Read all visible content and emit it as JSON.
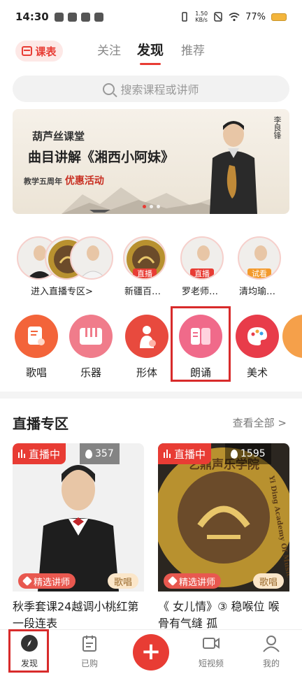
{
  "status_bar": {
    "time": "14:30",
    "speed_top": "1.50",
    "speed_bottom": "KB/s",
    "battery": "77%"
  },
  "header": {
    "schedule_label": "课表",
    "tabs": [
      {
        "label": "关注"
      },
      {
        "label": "发现"
      },
      {
        "label": "推荐"
      }
    ],
    "active_tab": "发现"
  },
  "search": {
    "placeholder": "搜索课程或讲师"
  },
  "banner": {
    "line1": "葫芦丝课堂",
    "line2": "曲目讲解《湘西小阿妹》",
    "line3_prefix": "教学五周年",
    "line3_highlight": "优惠活动",
    "seal": "李良锋",
    "page": 1,
    "page_count": 3
  },
  "live_entries": {
    "enter_label": "进入直播专区>",
    "teachers": [
      {
        "name": "新疆百…",
        "badge": "直播"
      },
      {
        "name": "罗老师…",
        "badge": "直播"
      },
      {
        "name": "清均瑜…",
        "badge": "试看"
      }
    ]
  },
  "categories": [
    {
      "label": "歌唱",
      "color": "#f3643a",
      "icon": "music-note-icon"
    },
    {
      "label": "乐器",
      "color": "#f07c8b",
      "icon": "piano-icon"
    },
    {
      "label": "形体",
      "color": "#e84a3e",
      "icon": "dancer-icon"
    },
    {
      "label": "朗诵",
      "color": "#f06a8a",
      "icon": "book-icon"
    },
    {
      "label": "美术",
      "color": "#e83c4a",
      "icon": "palette-icon"
    }
  ],
  "live_section": {
    "title": "直播专区",
    "see_all": "查看全部 >",
    "cards": [
      {
        "live_label": "直播中",
        "viewers": "357",
        "tutor_label": "精选讲师",
        "genre": "歌唱",
        "title": "秋季套课24越调小桃红第一段连表"
      },
      {
        "live_label": "直播中",
        "viewers": "1595",
        "tutor_label": "精选讲师",
        "genre": "歌唱",
        "title": "《 女儿情》③ 稳喉位 喉骨有气缝 孤",
        "logo_text": "艺鼎声乐学院",
        "logo_text_en": "Yi Ding Academy Of Music"
      }
    ]
  },
  "bottom_nav": {
    "items": [
      {
        "label": "发现",
        "icon": "compass-icon"
      },
      {
        "label": "已购",
        "icon": "clipboard-icon"
      },
      {
        "label": "+",
        "icon": "plus-icon"
      },
      {
        "label": "短视频",
        "icon": "video-camera-icon"
      },
      {
        "label": "我的",
        "icon": "user-icon"
      }
    ]
  }
}
